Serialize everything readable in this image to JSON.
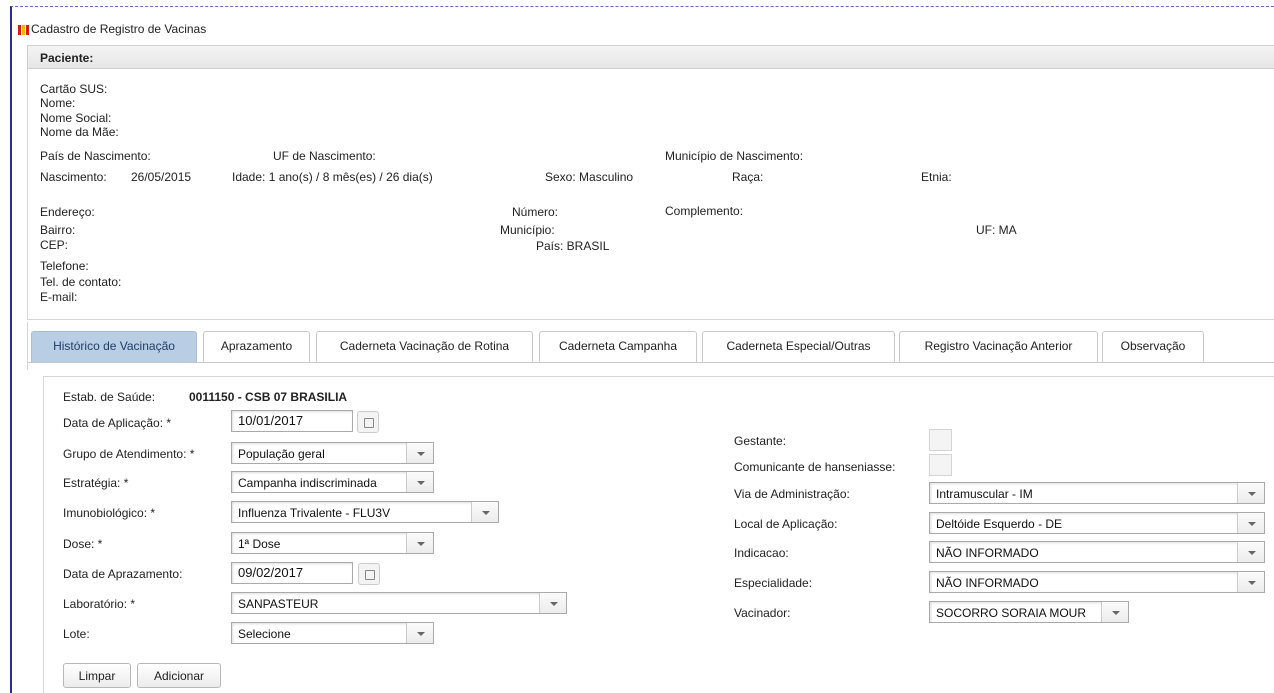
{
  "window": {
    "title": "Cadastro de Registro de Vacinas",
    "logo_colors": [
      "#d7191c",
      "#f5b800",
      "#d7191c"
    ]
  },
  "patient": {
    "header": "Paciente:",
    "cartao_sus": "Cartão SUS:",
    "nome": "Nome:",
    "nome_social": "Nome Social:",
    "nome_mae": "Nome da Mãe:",
    "pais_nascimento": "País de Nascimento:",
    "uf_nascimento": "UF de Nascimento:",
    "municipio_nascimento": "Município de Nascimento:",
    "nascimento_label": "Nascimento:",
    "nascimento_value": "26/05/2015",
    "idade": "Idade: 1 ano(s) / 8 mês(es) / 26 dia(s)",
    "sexo": "Sexo: Masculino",
    "raca": "Raça:",
    "etnia": "Etnia:",
    "endereco": "Endereço:",
    "numero": "Número:",
    "complemento": "Complemento:",
    "bairro": "Bairro:",
    "municipio": "Município:",
    "uf": "UF: MA",
    "cep": "CEP:",
    "pais": "País: BRASIL",
    "telefone": "Telefone:",
    "tel_contato": "Tel. de contato:",
    "email": "E-mail:"
  },
  "tabs": [
    {
      "label": "Histórico de Vacinação",
      "active": true
    },
    {
      "label": "Aprazamento",
      "active": false
    },
    {
      "label": "Caderneta Vacinação de Rotina",
      "active": false
    },
    {
      "label": "Caderneta Campanha",
      "active": false
    },
    {
      "label": "Caderneta Especial/Outras",
      "active": false
    },
    {
      "label": "Registro Vacinação Anterior",
      "active": false
    },
    {
      "label": "Observação",
      "active": false
    }
  ],
  "form": {
    "estab_label": "Estab. de Saúde:",
    "estab_value": "0011150 - CSB 07 BRASILIA",
    "data_aplicacao_label": "Data de Aplicação:  *",
    "data_aplicacao_value": "10/01/2017",
    "grupo_label": "Grupo de Atendimento:  *",
    "grupo_value": "População geral",
    "estrategia_label": "Estratégia:  *",
    "estrategia_value": "Campanha indiscriminada",
    "imuno_label": "Imunobiológico:  *",
    "imuno_value": "Influenza Trivalente - FLU3V",
    "dose_label": "Dose:  *",
    "dose_value": "1ª Dose",
    "data_aprazamento_label": "Data de Aprazamento:",
    "data_aprazamento_value": "09/02/2017",
    "laboratorio_label": "Laboratório:  *",
    "laboratorio_value": "SANPASTEUR",
    "lote_label": "Lote:",
    "lote_value": "Selecione",
    "gestante_label": "Gestante:",
    "hanseniasse_label": "Comunicante de hanseniasse:",
    "via_label": "Via de Administração:",
    "via_value": "Intramuscular - IM",
    "local_label": "Local de Aplicação:",
    "local_value": "Deltóide Esquerdo - DE",
    "indicacao_label": "Indicacao:",
    "indicacao_value": "NÃO INFORMADO",
    "especialidade_label": "Especialidade:",
    "especialidade_value": "NÃO INFORMADO",
    "vacinador_label": "Vacinador:",
    "vacinador_value": "SOCORRO SORAIA MOUR",
    "limpar_label": "Limpar",
    "adicionar_label": "Adicionar"
  }
}
